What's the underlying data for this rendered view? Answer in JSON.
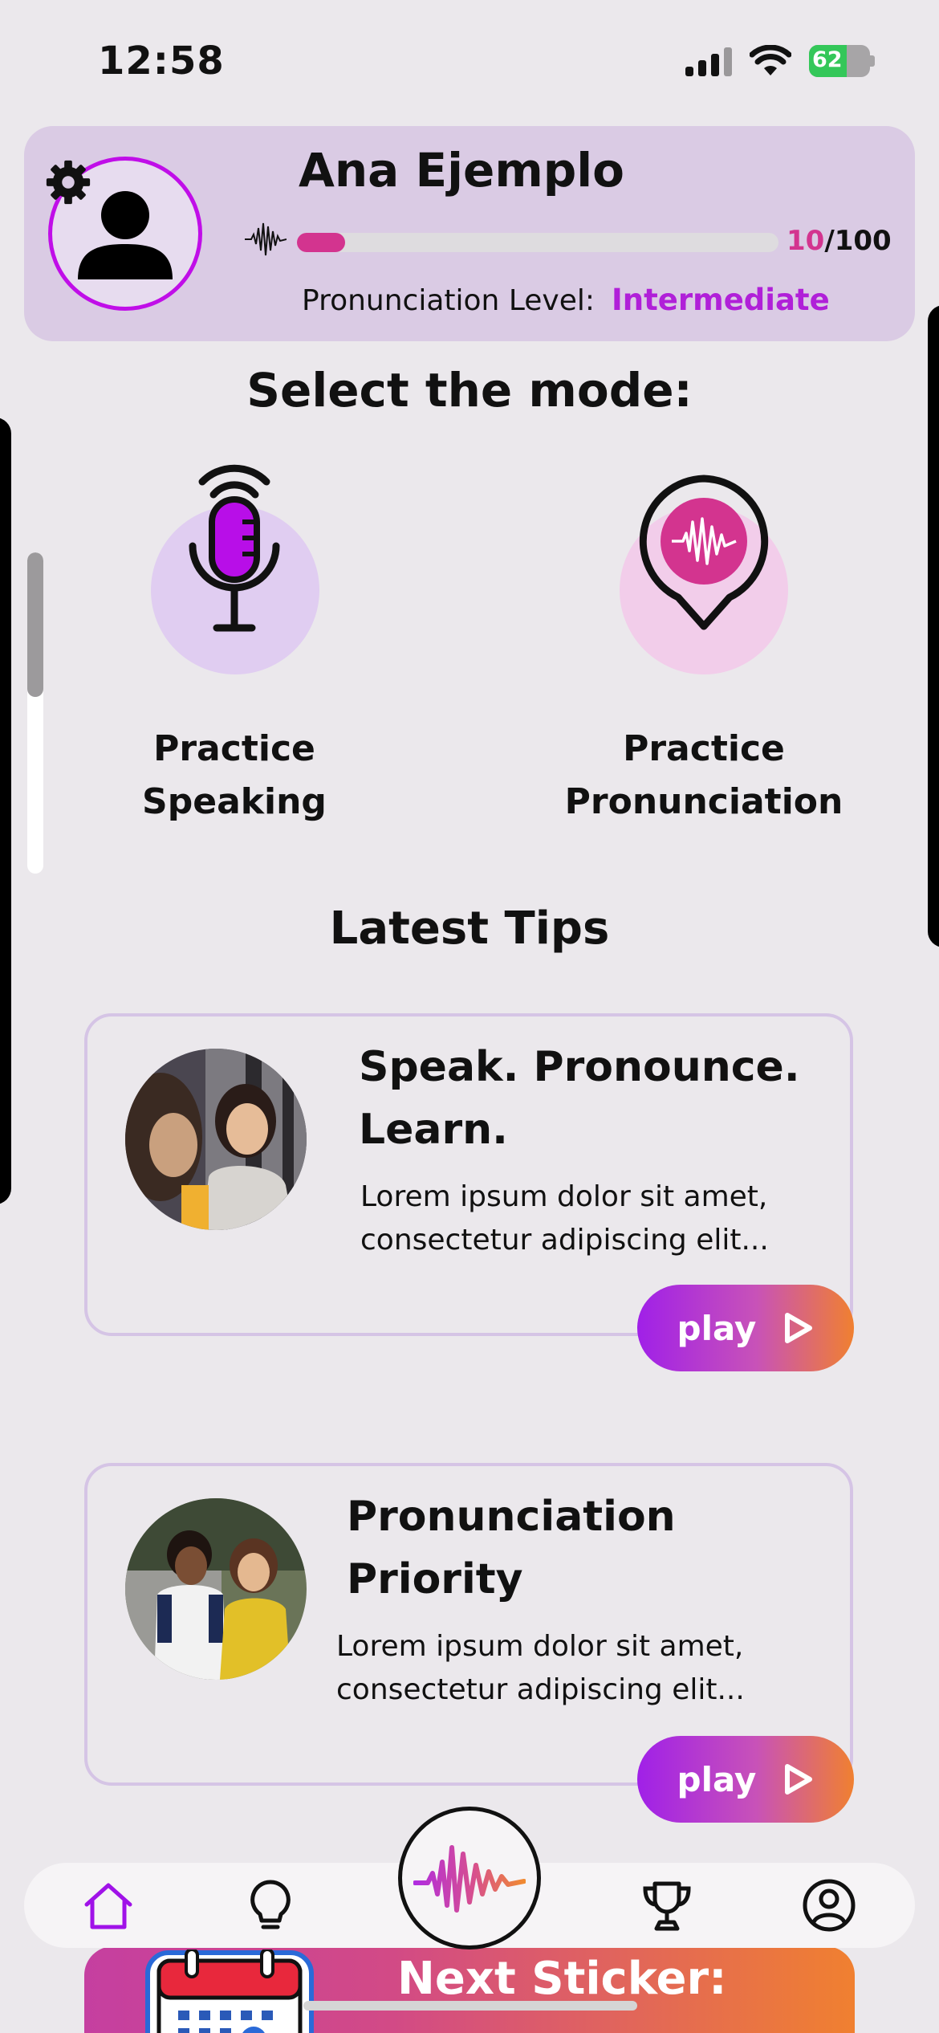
{
  "status_bar": {
    "time": "12:58",
    "battery": "62"
  },
  "profile": {
    "name": "Ana Ejemplo",
    "progress_current": "10",
    "progress_total": "/100",
    "progress_fraction": 0.1,
    "level_label": "Pronunciation Level:",
    "level_value": "Intermediate"
  },
  "modes": {
    "title": "Select the mode:",
    "items": [
      {
        "label_line1": "Practice",
        "label_line2": "Speaking"
      },
      {
        "label_line1": "Practice",
        "label_line2": "Pronunciation"
      }
    ]
  },
  "tips": {
    "title": "Latest Tips",
    "items": [
      {
        "title_line1": "Speak. Pronounce.",
        "title_line2": "Learn.",
        "desc_line1": "Lorem ipsum dolor sit amet,",
        "desc_line2": "consectetur adipiscing elit...",
        "play_label": "play"
      },
      {
        "title_line1": "Pronunciation",
        "title_line2": "Priority",
        "desc_line1": "Lorem ipsum dolor sit amet,",
        "desc_line2": "consectetur adipiscing elit...",
        "play_label": "play"
      }
    ]
  },
  "sticker": {
    "label": "Next Sticker:"
  },
  "nav": {
    "items": [
      "home-icon",
      "lightbulb-icon",
      "soundwave-icon",
      "trophy-icon",
      "profile-icon"
    ],
    "active": "home-icon"
  },
  "colors": {
    "accent_purple": "#c00ee8",
    "accent_pink": "#d3348f",
    "gradient_end": "#f08030",
    "card_bg": "#dacbe4"
  }
}
